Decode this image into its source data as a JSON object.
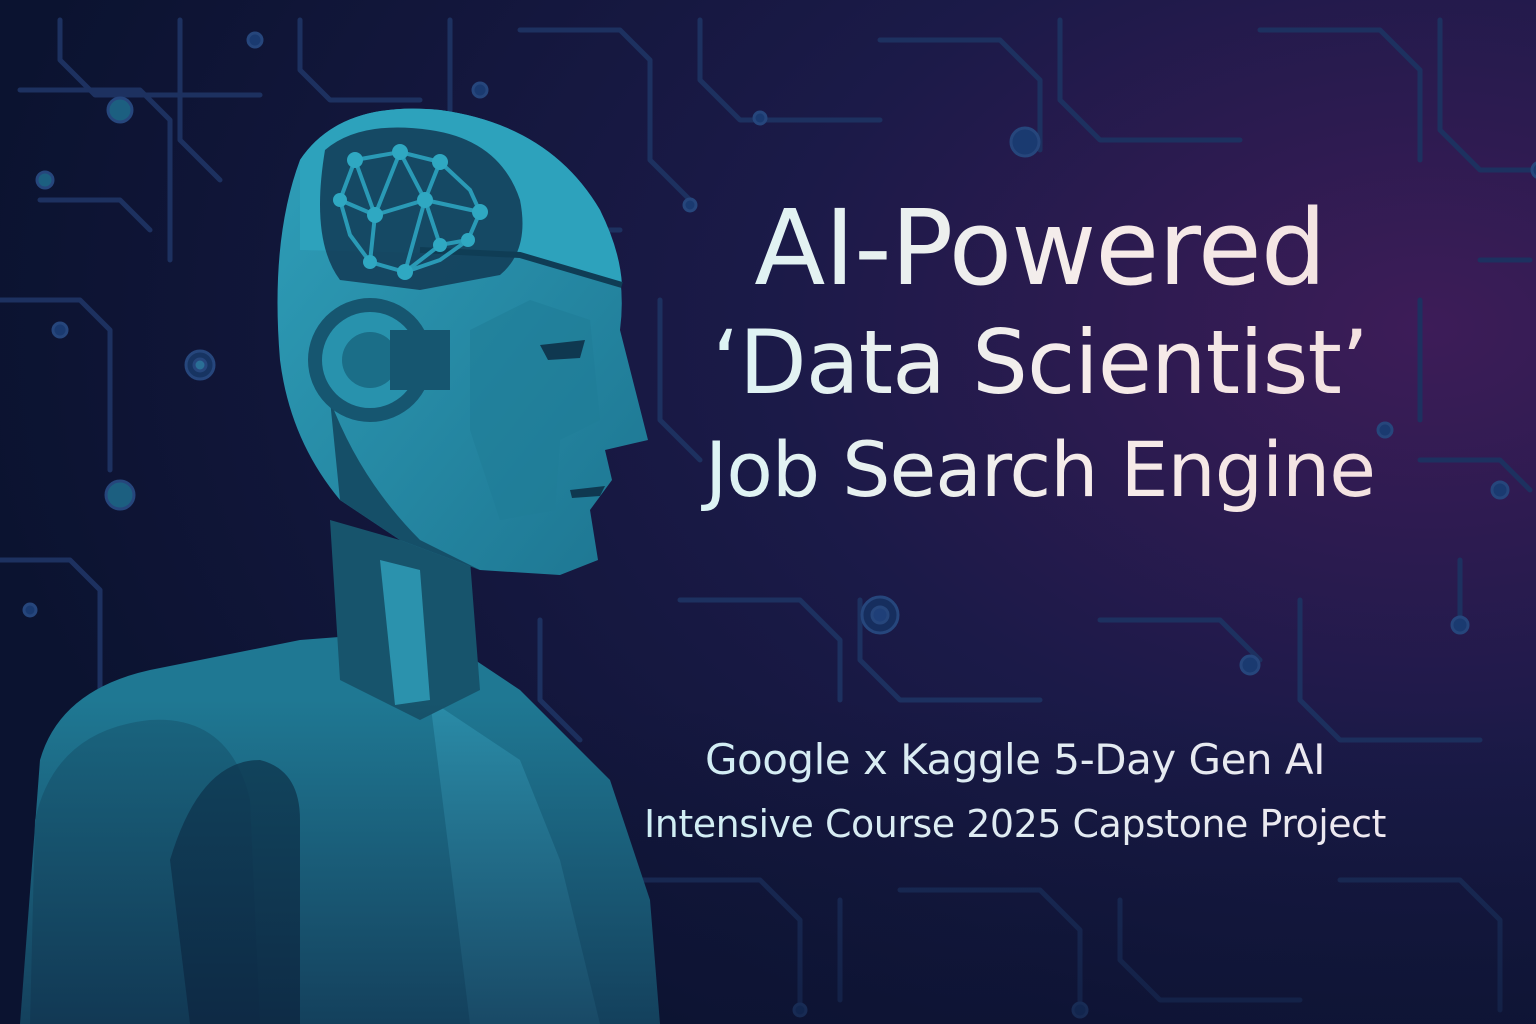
{
  "poster": {
    "title_line1": "AI-Powered",
    "title_line2": "‘Data Scientist’",
    "title_line3": "Job Search Engine",
    "subtitle_line1": "Google x Kaggle 5-Day Gen AI",
    "subtitle_line2": "Intensive Course 2025 Capstone Project"
  },
  "colors": {
    "background_dark": "#0c1330",
    "background_purple": "#3a1b55",
    "robot_teal": "#2a93ad",
    "robot_shadow": "#17566f",
    "title_text": "#f4ebe8",
    "circuit_lines": "#1f3360"
  }
}
